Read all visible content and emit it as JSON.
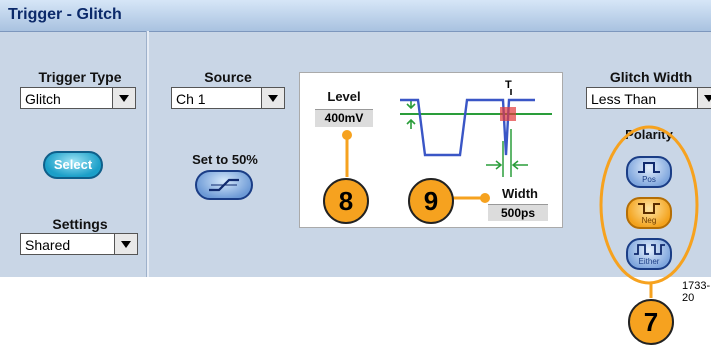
{
  "title": "Trigger - Glitch",
  "trigger_type": {
    "label": "Trigger Type",
    "value": "Glitch"
  },
  "select_label": "Select",
  "settings": {
    "label": "Settings",
    "value": "Shared"
  },
  "source": {
    "label": "Source",
    "value": "Ch 1"
  },
  "set50_label": "Set to 50%",
  "diagram": {
    "level_label": "Level",
    "level_value": "400mV",
    "width_label": "Width",
    "width_value": "500ps",
    "trigger_marker": "T"
  },
  "glitch_width": {
    "label": "Glitch Width",
    "value": "Less Than"
  },
  "polarity": {
    "label": "Polarity",
    "buttons": [
      {
        "label": "Pos",
        "active": false
      },
      {
        "label": "Neg",
        "active": true
      },
      {
        "label": "Either",
        "active": false
      }
    ]
  },
  "callouts": [
    "8",
    "9",
    "7"
  ],
  "figure_id": "1733-20",
  "colors": {
    "accent_orange": "#f6a21f",
    "panel_bg": "#c9d6e6",
    "waveform_blue": "#3a56c6",
    "level_green": "#2a9d3a",
    "glitch_red": "#e23a3a"
  }
}
